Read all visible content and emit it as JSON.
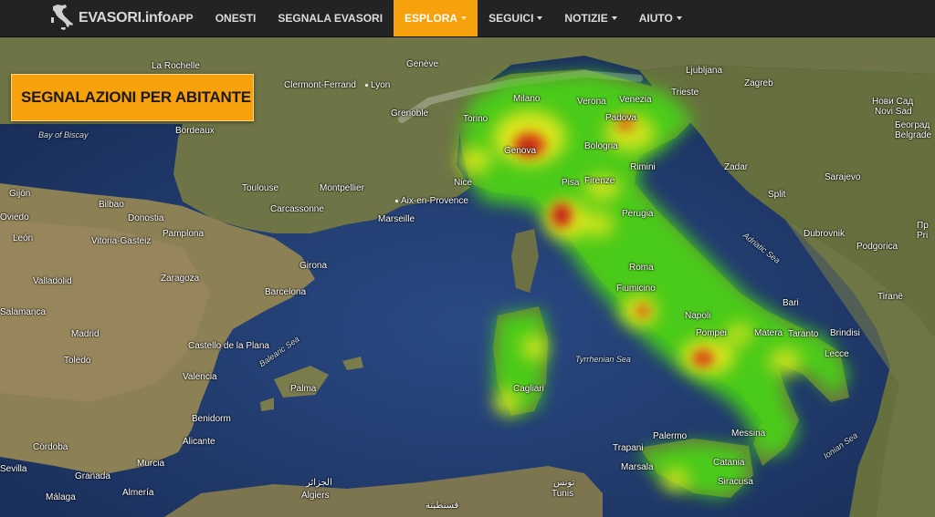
{
  "brand": {
    "name": "EVASORI.info",
    "logo_icon": "italy-silhouette-icon"
  },
  "nav": {
    "items": [
      {
        "label": "APP",
        "dropdown": false,
        "active": false
      },
      {
        "label": "ONESTI",
        "dropdown": false,
        "active": false
      },
      {
        "label": "SEGNALA EVASORI",
        "dropdown": false,
        "active": false
      },
      {
        "label": "ESPLORA",
        "dropdown": true,
        "active": true
      },
      {
        "label": "SEGUICI",
        "dropdown": true,
        "active": false
      },
      {
        "label": "NOTIZIE",
        "dropdown": true,
        "active": false
      },
      {
        "label": "AIUTO",
        "dropdown": true,
        "active": false
      }
    ]
  },
  "overlay": {
    "title": "SEGNALAZIONI PER ABITANTE"
  },
  "map": {
    "labels": [
      {
        "id": "la-rochelle",
        "text": "La Rochelle"
      },
      {
        "id": "clermont",
        "text": "Clermont-Ferrand"
      },
      {
        "id": "lyon",
        "text": "Lyon"
      },
      {
        "id": "geneve",
        "text": "Genève"
      },
      {
        "id": "grenoble",
        "text": "Grenoble"
      },
      {
        "id": "bordeaux",
        "text": "Bordeaux"
      },
      {
        "id": "bay-of-biscay",
        "text": "Bay of Biscay"
      },
      {
        "id": "toulouse",
        "text": "Toulouse"
      },
      {
        "id": "montpellier",
        "text": "Montpellier"
      },
      {
        "id": "carcassonne",
        "text": "Carcassonne"
      },
      {
        "id": "aix",
        "text": "Aix-en-Provence"
      },
      {
        "id": "nice",
        "text": "Nice"
      },
      {
        "id": "marseille",
        "text": "Marseille"
      },
      {
        "id": "gijon",
        "text": "Gijón"
      },
      {
        "id": "oviedo",
        "text": "Oviedo"
      },
      {
        "id": "bilbao",
        "text": "Bilbao"
      },
      {
        "id": "donostia",
        "text": "Donostia"
      },
      {
        "id": "leon",
        "text": "León"
      },
      {
        "id": "vitoria",
        "text": "Vitoria-Gasteiz"
      },
      {
        "id": "pamplona",
        "text": "Pamplona"
      },
      {
        "id": "girona",
        "text": "Girona"
      },
      {
        "id": "zaragoza",
        "text": "Zaragoza"
      },
      {
        "id": "valladolid",
        "text": "Valladolid"
      },
      {
        "id": "barcelona",
        "text": "Barcelona"
      },
      {
        "id": "salamanca",
        "text": "Salamanca"
      },
      {
        "id": "madrid",
        "text": "Madrid"
      },
      {
        "id": "toledo",
        "text": "Toledo"
      },
      {
        "id": "castello",
        "text": "Castello de la Plana"
      },
      {
        "id": "balearic-sea",
        "text": "Balearic Sea"
      },
      {
        "id": "valencia",
        "text": "Valencia"
      },
      {
        "id": "palma",
        "text": "Palma"
      },
      {
        "id": "benidorm",
        "text": "Benidorm"
      },
      {
        "id": "alicante",
        "text": "Alicante"
      },
      {
        "id": "cordoba",
        "text": "Córdoba"
      },
      {
        "id": "sevilla",
        "text": "Sevilla"
      },
      {
        "id": "granada",
        "text": "Granada"
      },
      {
        "id": "murcia",
        "text": "Murcia"
      },
      {
        "id": "almeria",
        "text": "Almería"
      },
      {
        "id": "malaga",
        "text": "Málaga"
      },
      {
        "id": "alger-ar",
        "text": "الجزائر"
      },
      {
        "id": "algiers",
        "text": "Algiers"
      },
      {
        "id": "tunis-ar",
        "text": "تونس"
      },
      {
        "id": "tunis",
        "text": "Tunis"
      },
      {
        "id": "constantine-ar",
        "text": "قسنطينة"
      },
      {
        "id": "ljubljana",
        "text": "Ljubljana"
      },
      {
        "id": "zagreb",
        "text": "Zagreb"
      },
      {
        "id": "novi-sad-cyr",
        "text": "Нови Сад"
      },
      {
        "id": "novi-sad",
        "text": "Novi Sad"
      },
      {
        "id": "beograd-cyr",
        "text": "Београд"
      },
      {
        "id": "belgrade",
        "text": "Belgrade"
      },
      {
        "id": "zadar",
        "text": "Zadar"
      },
      {
        "id": "sarajevo",
        "text": "Sarajevo"
      },
      {
        "id": "split",
        "text": "Split"
      },
      {
        "id": "dubrovnik",
        "text": "Dubrovnik"
      },
      {
        "id": "podgorica",
        "text": "Podgorica"
      },
      {
        "id": "pristina-cyr",
        "text": "Пр"
      },
      {
        "id": "pristina",
        "text": "Pri"
      },
      {
        "id": "tirane",
        "text": "Tiranë"
      },
      {
        "id": "adriatic-sea",
        "text": "Adriatic Sea"
      },
      {
        "id": "tyrrhenian-sea",
        "text": "Tyrrhenian Sea"
      },
      {
        "id": "ionian-sea",
        "text": "Ionian Sea"
      },
      {
        "id": "milano",
        "text": "Milano"
      },
      {
        "id": "torino",
        "text": "Torino"
      },
      {
        "id": "verona",
        "text": "Verona"
      },
      {
        "id": "venezia",
        "text": "Venezia"
      },
      {
        "id": "padova",
        "text": "Padova"
      },
      {
        "id": "trieste",
        "text": "Trieste"
      },
      {
        "id": "genova",
        "text": "Genova"
      },
      {
        "id": "bologna",
        "text": "Bologna"
      },
      {
        "id": "rimini",
        "text": "Rimini"
      },
      {
        "id": "pisa",
        "text": "Pisa"
      },
      {
        "id": "firenze",
        "text": "Firenze"
      },
      {
        "id": "perugia",
        "text": "Perugia"
      },
      {
        "id": "roma",
        "text": "Roma"
      },
      {
        "id": "fiumicino",
        "text": "Fiumicino"
      },
      {
        "id": "napoli",
        "text": "Napoli"
      },
      {
        "id": "pompei",
        "text": "Pompei"
      },
      {
        "id": "bari",
        "text": "Bari"
      },
      {
        "id": "matera",
        "text": "Matera"
      },
      {
        "id": "taranto",
        "text": "Taranto"
      },
      {
        "id": "brindisi",
        "text": "Brindisi"
      },
      {
        "id": "lecce",
        "text": "Lecce"
      },
      {
        "id": "cagliari",
        "text": "Cagliari"
      },
      {
        "id": "palermo",
        "text": "Palermo"
      },
      {
        "id": "trapani",
        "text": "Trapani"
      },
      {
        "id": "marsala",
        "text": "Marsala"
      },
      {
        "id": "messina",
        "text": "Messina"
      },
      {
        "id": "catania",
        "text": "Catania"
      },
      {
        "id": "siracusa",
        "text": "Siracusa"
      }
    ]
  },
  "colors": {
    "navbar": "#222325",
    "accent": "#f7a10c",
    "sea": "#1d3563",
    "land": "#6a7242"
  }
}
